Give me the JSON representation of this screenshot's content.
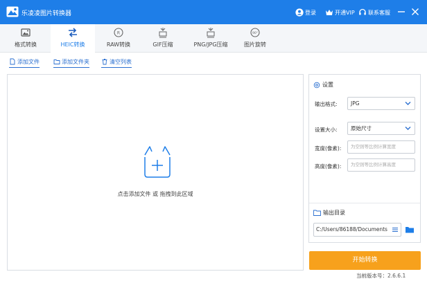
{
  "titlebar": {
    "app_title": "乐凌凌图片转换器",
    "login": "登录",
    "vip": "开通VIP",
    "contact": "联系客服"
  },
  "tools": [
    {
      "label": "格式转换",
      "icon": "image-convert-icon"
    },
    {
      "label": "HEIC转换",
      "icon": "swap-arrows-icon",
      "active": true
    },
    {
      "label": "RAW转换",
      "icon": "raw-icon"
    },
    {
      "label": "GIF压缩",
      "icon": "gif-compress-icon"
    },
    {
      "label": "PNG/JPG压缩",
      "icon": "png-jpg-compress-icon"
    },
    {
      "label": "图片旋转",
      "icon": "rotate-icon"
    }
  ],
  "actions": {
    "add_file": "添加文件",
    "add_folder": "添加文件夹",
    "clear_list": "清空列表"
  },
  "drop": {
    "hint": "点击添加文件 或 拖拽到此区域"
  },
  "settings": {
    "title": "设置",
    "format_label": "输出格式:",
    "format_value": "JPG",
    "size_label": "设置大小:",
    "size_value": "原始尺寸",
    "width_label": "宽度(像素):",
    "width_placeholder": "为空则等比例计算宽度",
    "height_label": "高度(像素):",
    "height_placeholder": "为空则等比例计算高度",
    "output_title": "输出目录",
    "output_path": "C:/Users/86188/Documents"
  },
  "start_button": "开始转换",
  "version": "当前版本号：2.6.6.1",
  "colors": {
    "brand_blue": "#1e7ee8",
    "start_orange": "#f7a11c"
  }
}
